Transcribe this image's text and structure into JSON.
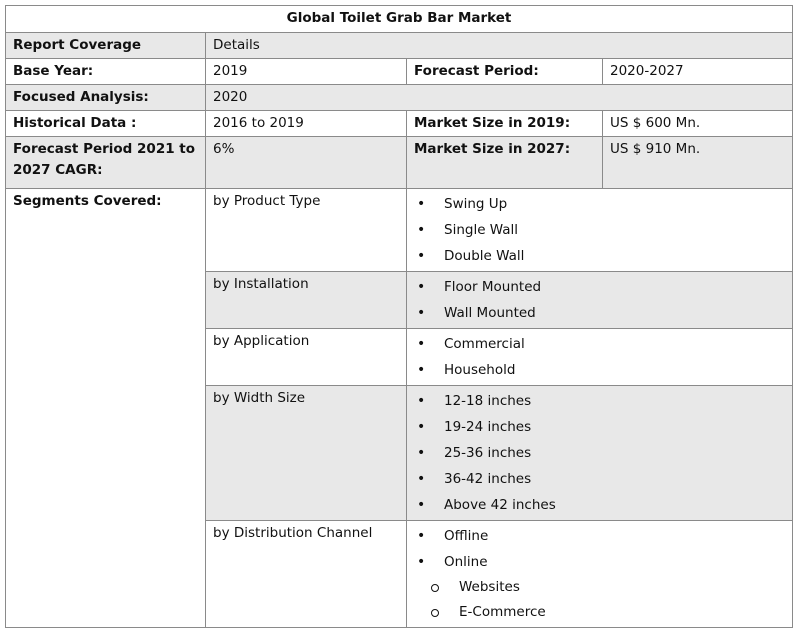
{
  "title": "Global Toilet Grab Bar Market",
  "header": {
    "col1": "Report Coverage",
    "col2": "Details"
  },
  "base_year": {
    "label": "Base Year:",
    "value": "2019",
    "label2": "Forecast Period:",
    "value2": "2020-2027"
  },
  "focused": {
    "label": "Focused Analysis:",
    "value": "2020"
  },
  "historical": {
    "label": "Historical Data :",
    "value": "2016 to 2019",
    "label2": "Market Size in 2019:",
    "value2": "US $ 600 Mn."
  },
  "cagr": {
    "label": "Forecast Period 2021 to 2027 CAGR:",
    "value": "6%",
    "label2": "Market Size in 2027:",
    "value2": "US $ 910 Mn."
  },
  "segments": {
    "label": "Segments Covered:",
    "groups": [
      {
        "name": "by Product Type",
        "items": [
          "Swing Up",
          "Single Wall",
          "Double Wall"
        ]
      },
      {
        "name": "by Installation",
        "items": [
          "Floor Mounted",
          "Wall Mounted"
        ]
      },
      {
        "name": "by Application",
        "items": [
          "Commercial",
          "Household"
        ]
      },
      {
        "name": "by Width Size",
        "items": [
          "12-18 inches",
          "19-24 inches",
          "25-36 inches",
          "36-42 inches",
          "Above 42 inches"
        ]
      },
      {
        "name": "by Distribution Channel",
        "items": [
          "Offline",
          "Online"
        ],
        "subitems": [
          "Websites",
          "E-Commerce"
        ]
      }
    ]
  }
}
